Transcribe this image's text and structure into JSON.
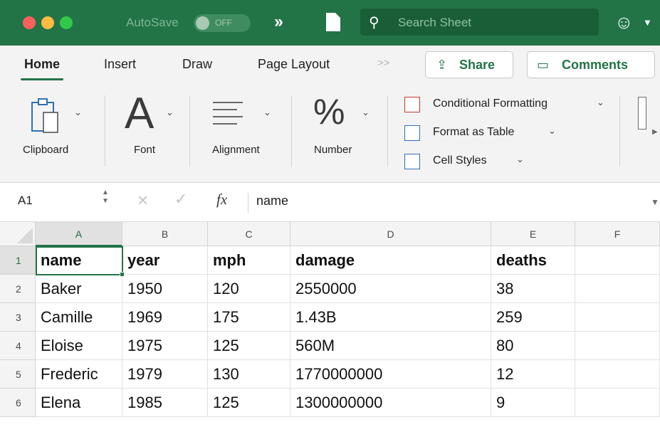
{
  "titlebar": {
    "autosave_label": "AutoSave",
    "autosave_state": "OFF",
    "search_placeholder": "Search Sheet",
    "colors": {
      "bar": "#227447",
      "search": "#1a5e37"
    }
  },
  "ribbon": {
    "tabs": [
      "Home",
      "Insert",
      "Draw",
      "Page Layout"
    ],
    "active_tab": "Home",
    "share_label": "Share",
    "comments_label": "Comments",
    "groups": {
      "clipboard": "Clipboard",
      "font": "Font",
      "alignment": "Alignment",
      "number": "Number"
    },
    "styles": [
      "Conditional Formatting",
      "Format as Table",
      "Cell Styles"
    ],
    "icons": {
      "clipboard": "clipboard-icon",
      "font": "font-letter-a-icon",
      "alignment": "align-lines-icon",
      "number": "percent-icon",
      "share": "share-arrow-icon",
      "comments": "speech-bubble-icon"
    }
  },
  "formula_bar": {
    "name_box": "A1",
    "fx_label": "fx",
    "content": "name"
  },
  "sheet": {
    "columns": [
      "A",
      "B",
      "C",
      "D",
      "E",
      "F"
    ],
    "selected_cell": "A1",
    "rows": [
      {
        "num": "1",
        "cells": [
          "name",
          "year",
          "mph",
          "damage",
          "deaths",
          ""
        ]
      },
      {
        "num": "2",
        "cells": [
          "Baker",
          "1950",
          "120",
          "2550000",
          "38",
          ""
        ]
      },
      {
        "num": "3",
        "cells": [
          "Camille",
          "1969",
          "175",
          "1.43B",
          "259",
          ""
        ]
      },
      {
        "num": "4",
        "cells": [
          "Eloise",
          "1975",
          "125",
          "560M",
          "80",
          ""
        ]
      },
      {
        "num": "5",
        "cells": [
          "Frederic",
          "1979",
          "130",
          "1770000000",
          "12",
          ""
        ]
      },
      {
        "num": "6",
        "cells": [
          "Elena",
          "1985",
          "125",
          "1300000000",
          "9",
          ""
        ]
      }
    ]
  }
}
